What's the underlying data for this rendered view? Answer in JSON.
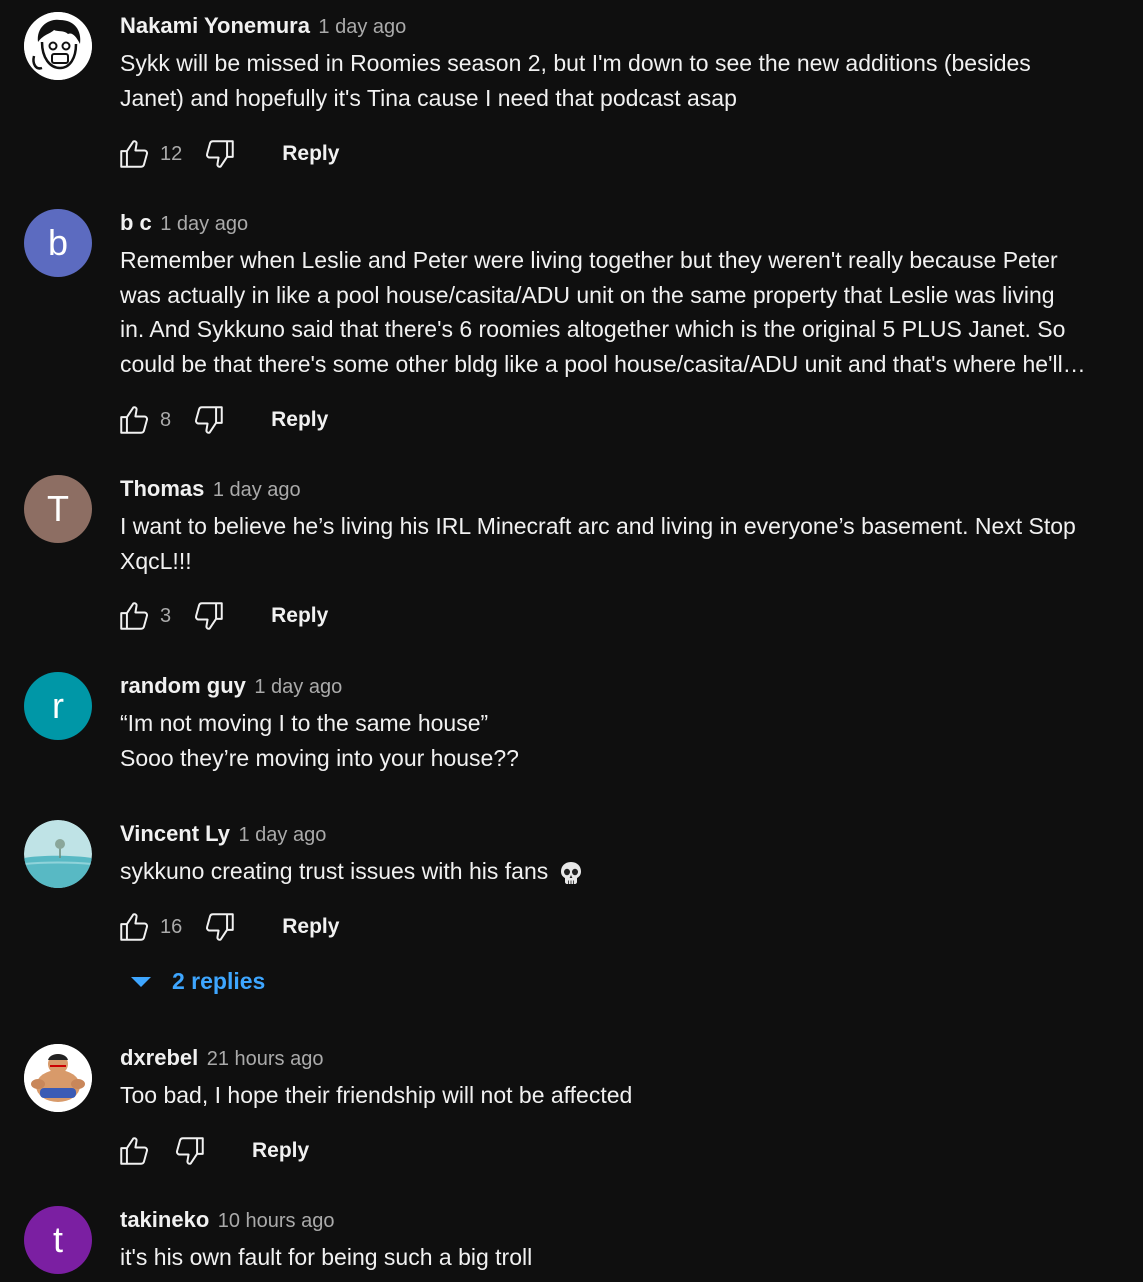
{
  "comments": [
    {
      "author": "Nakami Yonemura",
      "time": "1 day ago",
      "lines": [
        "Sykk will be missed in Roomies season 2, but I'm down to see the new additions (besides",
        "Janet) and hopefully it's Tina cause I need that podcast asap"
      ],
      "likes": "12",
      "reply": "Reply"
    },
    {
      "author": "b c",
      "time": "1 day ago",
      "avatar_letter": "b",
      "avatar_color": "#5c6bc0",
      "lines": [
        "Remember when Leslie and Peter were living together but they weren't really because Peter",
        "was actually in like a pool house/casita/ADU unit on the same property that Leslie was living",
        "in.  And Sykkuno said that there's 6 roomies altogether which is the original 5 PLUS Janet.  So",
        "could be that there's some other bldg like a pool house/casita/ADU unit and that's where he'll…"
      ],
      "likes": "8",
      "reply": "Reply"
    },
    {
      "author": "Thomas",
      "time": "1 day ago",
      "avatar_letter": "T",
      "avatar_color": "#8d6e63",
      "lines": [
        "I want to believe he’s living his IRL Minecraft arc and living in everyone’s basement. Next Stop",
        "XqcL!!!"
      ],
      "likes": "3",
      "reply": "Reply"
    },
    {
      "author": "random guy",
      "time": "1 day ago",
      "avatar_letter": "r",
      "avatar_color": "#0097a7",
      "lines": [
        "“Im not moving I to the same house”",
        "Sooo they’re moving into your house??"
      ]
    },
    {
      "author": "Vincent Ly",
      "time": "1 day ago",
      "lines": [
        "sykkuno creating trust issues with his fans"
      ],
      "likes": "16",
      "reply": "Reply",
      "replies_label": "2 replies"
    },
    {
      "author": "dxrebel",
      "time": "21 hours ago",
      "lines": [
        "Too bad, I hope their friendship will not be affected"
      ],
      "likes": "",
      "reply": "Reply"
    },
    {
      "author": "takineko",
      "time": "10 hours ago",
      "avatar_letter": "t",
      "avatar_color": "#7b1fa2",
      "lines": [
        "it's his own fault for being such a big troll"
      ]
    }
  ],
  "icons": {
    "like": "thumbs-up-icon",
    "dislike": "thumbs-down-icon",
    "expand": "caret-down-icon",
    "emoji": "skull-emoji"
  },
  "colors": {
    "background": "#0f0f0f",
    "text": "#f1f1f1",
    "secondary": "#aaaaaa",
    "link": "#3ea6ff"
  }
}
